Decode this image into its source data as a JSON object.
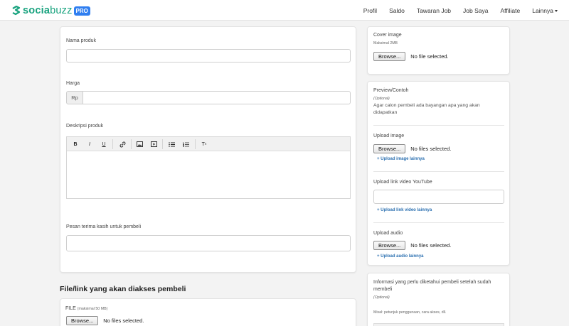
{
  "brand": {
    "name_bold": "socia",
    "name_rest": "buzz",
    "badge": "PRO"
  },
  "nav": {
    "items": [
      "Profil",
      "Saldo",
      "Tawaran Job",
      "Job Saya",
      "Affiliate",
      "Lainnya"
    ]
  },
  "form": {
    "nama_produk_label": "Nama produk",
    "harga_label": "Harga",
    "harga_prefix": "Rp",
    "deskripsi_label": "Deskripsi produk",
    "toolbar": {
      "bold": "B",
      "italic": "I",
      "underline": "U",
      "clear": "T"
    },
    "pesan_label": "Pesan terima kasih untuk pembeli"
  },
  "file_section": {
    "title": "File/link yang akan diakses pembeli",
    "file_label": "FILE",
    "file_hint": "(maksimal 50 MB)",
    "browse": "Browse...",
    "status": "No files selected."
  },
  "cover": {
    "title": "Cover image",
    "hint": "Maksimal 2MB",
    "browse": "Browse...",
    "status": "No file selected."
  },
  "preview": {
    "title": "Preview/Contoh",
    "optional": "(Optional)",
    "desc": "Agar calon pembeli ada bayangan apa yang akan didapatkan",
    "upload_image_label": "Upload image",
    "upload_image_browse": "Browse...",
    "upload_image_status": "No files selected.",
    "upload_image_more": "+ Upload image lainnya",
    "youtube_label": "Upload link video YouTube",
    "youtube_more": "+ Upload link video lainnya",
    "audio_label": "Upload audio",
    "audio_browse": "Browse...",
    "audio_status": "No files selected.",
    "audio_more": "+ Upload audio lainnya"
  },
  "info": {
    "title": "Informasi yang perlu diketahui pembeli setelah sudah membeli",
    "optional": "(Optional)",
    "hint": "Misal: petunjuk penggunaan, cara akses, dll."
  },
  "colors": {
    "brand_green": "#19a37f",
    "pro_blue": "#2f7ef0",
    "link_blue": "#2a6fb0"
  }
}
